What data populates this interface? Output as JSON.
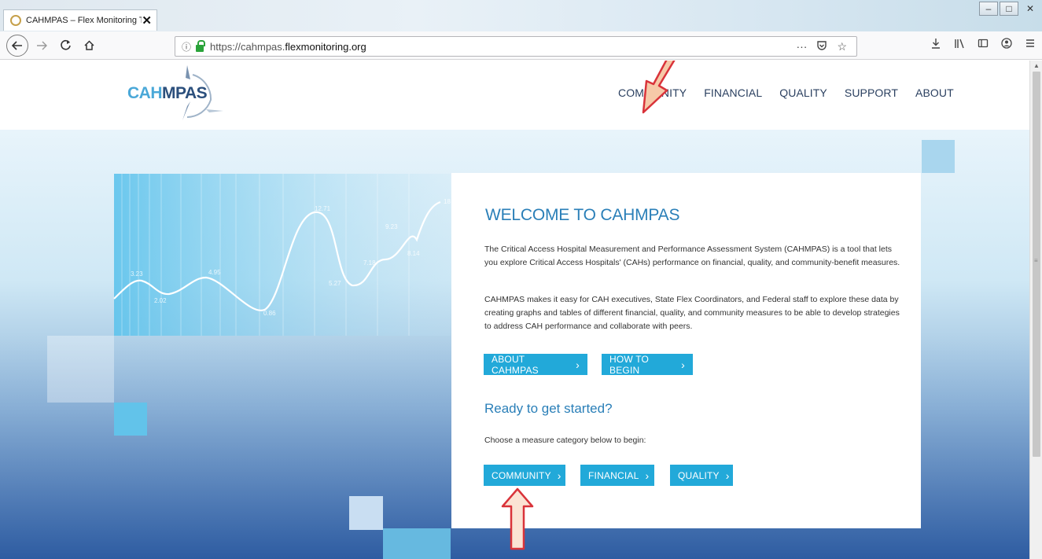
{
  "browser": {
    "tab_title": "CAHMPAS – Flex Monitoring Te",
    "tab_close": "✕",
    "url_prefix": "https://cahmpas.",
    "url_domain": "flexmonitoring.org",
    "page_actions": "···",
    "window_controls": [
      "–",
      "□",
      "✕"
    ]
  },
  "site": {
    "logo_cah": "CAH",
    "logo_mpas": "MPAS",
    "nav": [
      "COMMUNITY",
      "FINANCIAL",
      "QUALITY",
      "SUPPORT",
      "ABOUT"
    ]
  },
  "hero": {
    "chart_labels": [
      "3.23",
      "2.02",
      "4.95",
      "0.86",
      "12.71",
      "5.27",
      "7.18",
      "9.23",
      "8.14",
      "18"
    ]
  },
  "welcome": {
    "title": "WELCOME TO CAHMPAS",
    "p1": "The Critical Access Hospital Measurement and Performance Assessment System (CAHMPAS) is a tool that lets you explore Critical Access Hospitals' (CAHs) performance on financial, quality, and community-benefit measures.",
    "p2": "CAHMPAS makes it easy for CAH executives, State Flex Coordinators, and Federal staff to explore these data by creating graphs and tables of different financial, quality, and community measures to be able to develop strategies to address CAH performance and collaborate with peers.",
    "btn_about": "ABOUT CAHMPAS",
    "btn_howto": "HOW TO BEGIN",
    "ready": "Ready to get started?",
    "choose": "Choose a measure category below to begin:",
    "btn_community": "COMMUNITY",
    "btn_financial": "FINANCIAL",
    "btn_quality": "QUALITY",
    "chevron": "›"
  }
}
